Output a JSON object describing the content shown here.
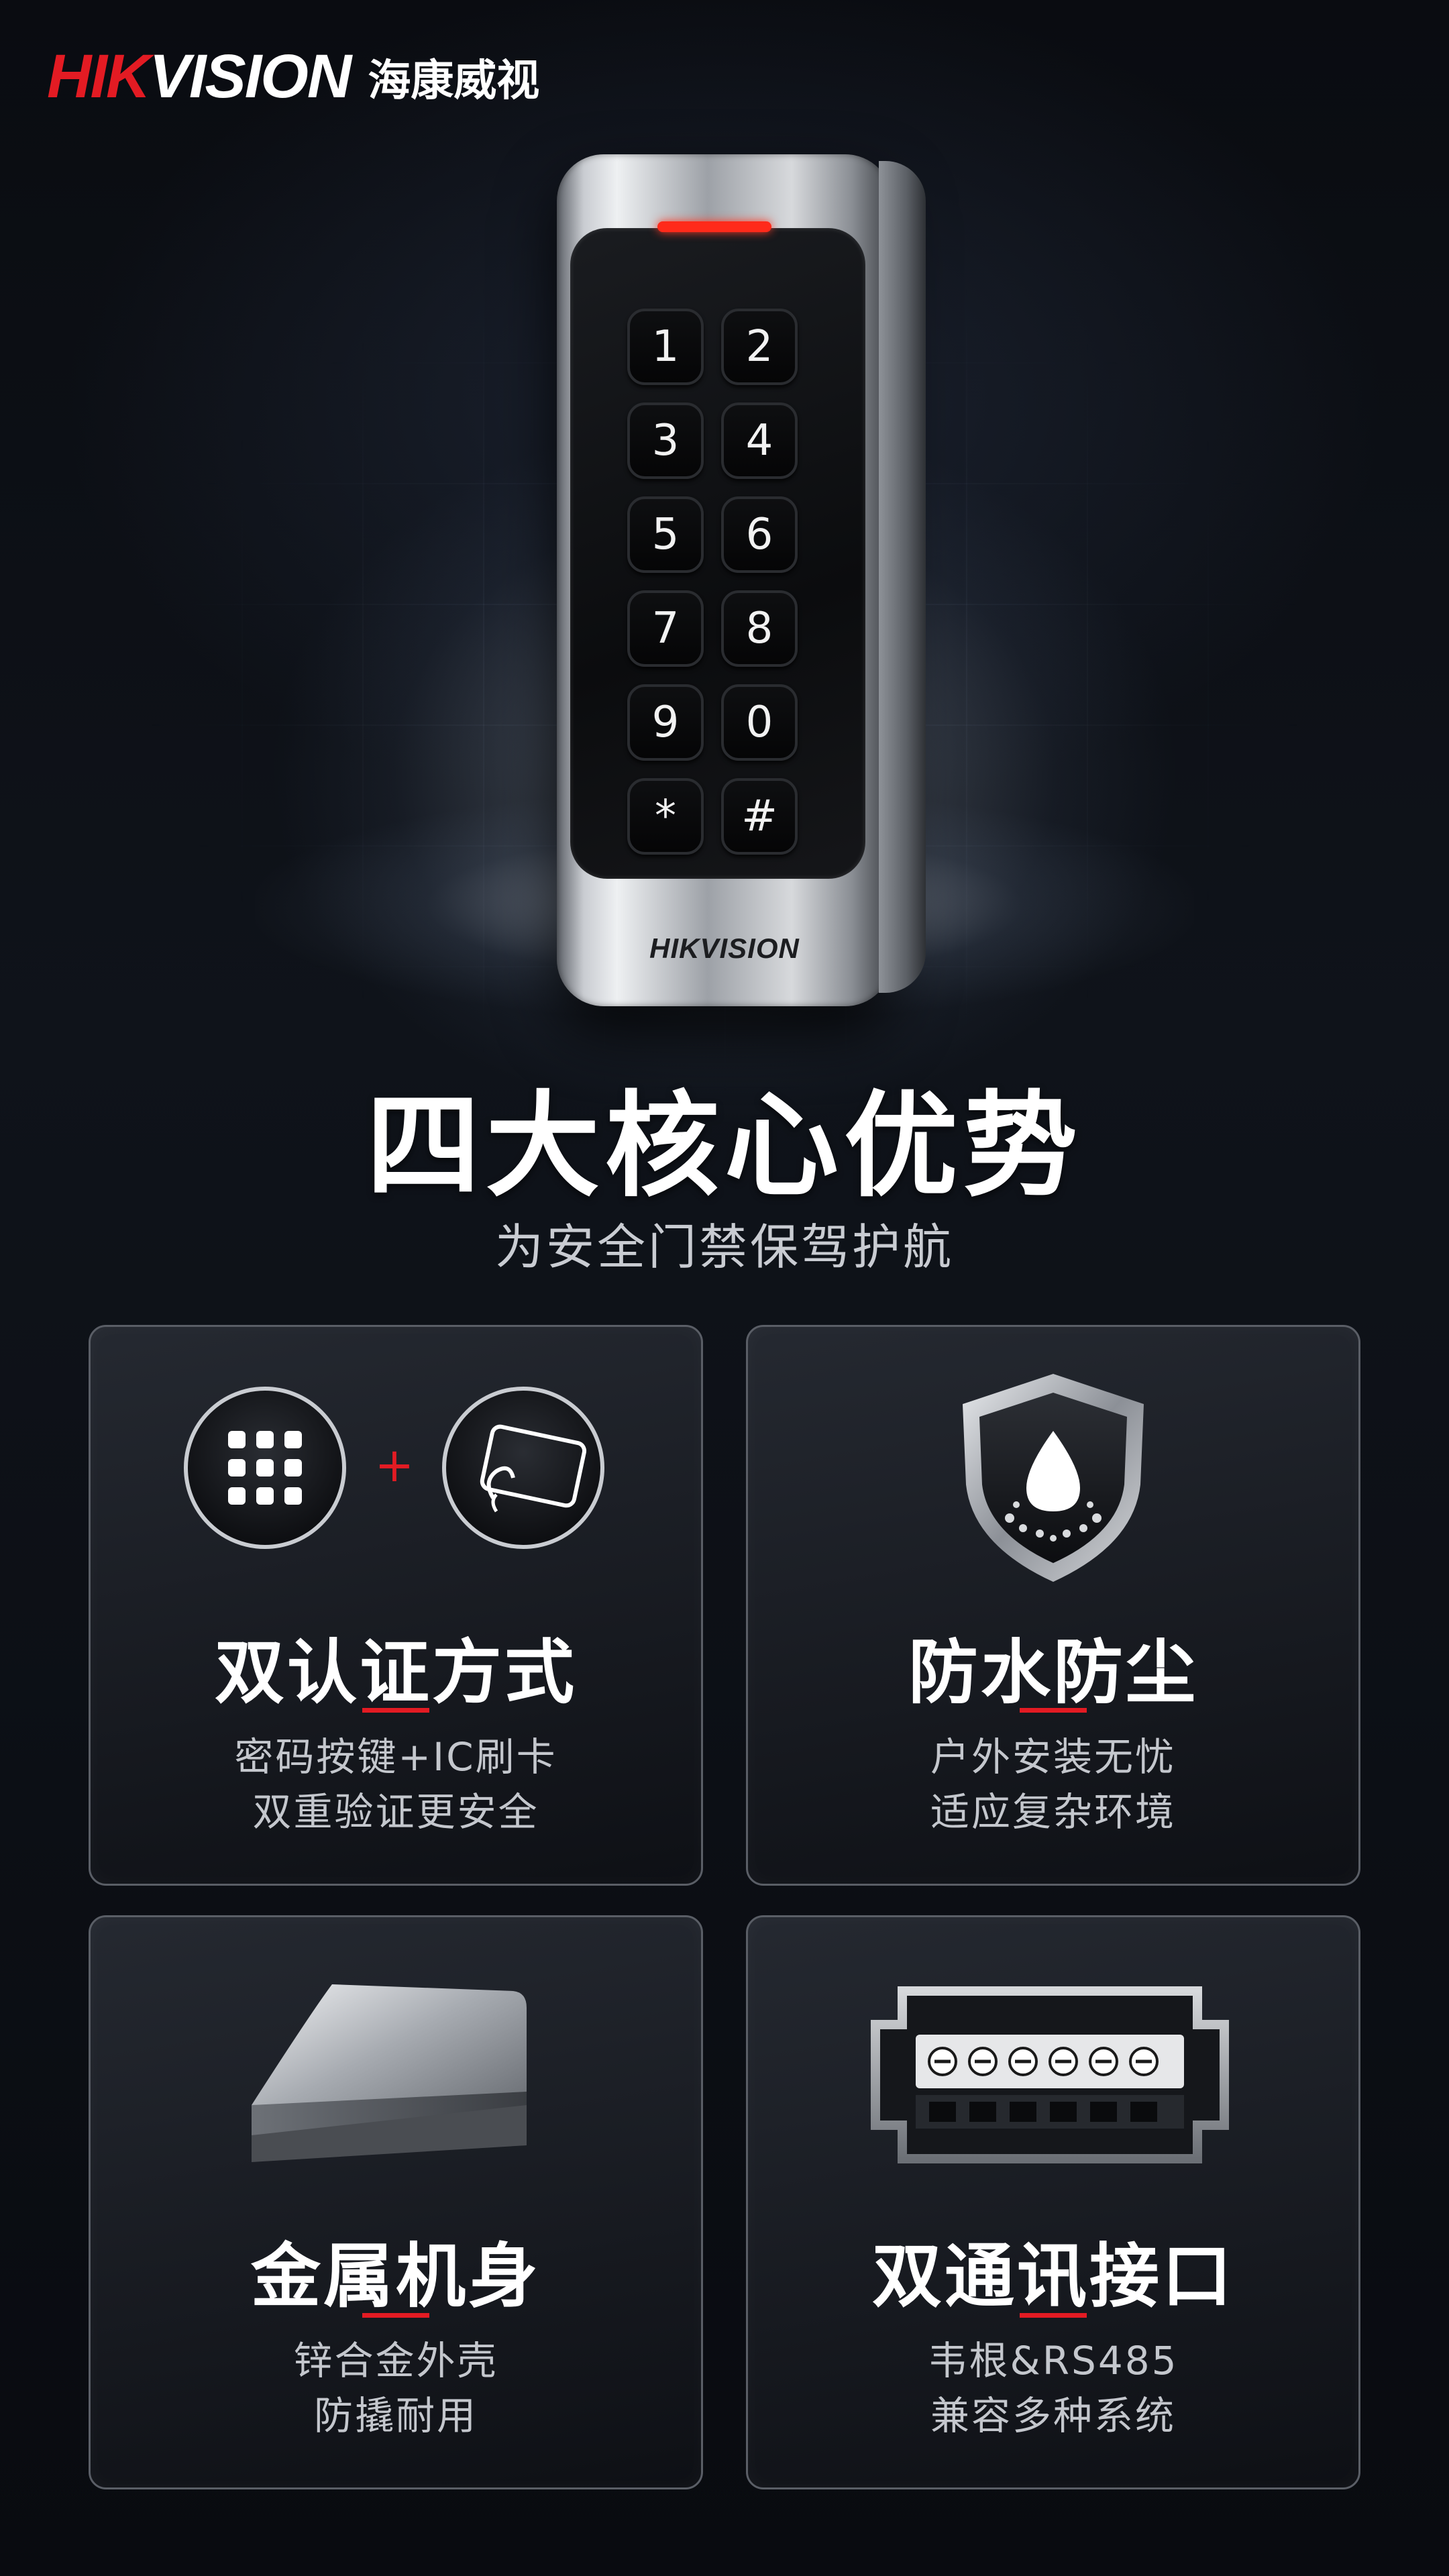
{
  "brand": {
    "logo_red": "HIK",
    "logo_white": "VISION",
    "logo_cn": "海康威视",
    "device_logo": "HIKVISION"
  },
  "keypad": {
    "keys": [
      "1",
      "2",
      "3",
      "4",
      "5",
      "6",
      "7",
      "8",
      "9",
      "0",
      "*",
      "#"
    ]
  },
  "headline": "四大核心优势",
  "subheadline": "为安全门禁保驾护航",
  "features": [
    {
      "title": "双认证方式",
      "line1": "密码按键+IC刷卡",
      "line2": "双重验证更安全",
      "icon": "keypad-plus-card-icon"
    },
    {
      "title": "防水防尘",
      "line1": "户外安装无忧",
      "line2": "适应复杂环境",
      "icon": "waterproof-shield-icon"
    },
    {
      "title": "金属机身",
      "line1": "锌合金外壳",
      "line2": "防撬耐用",
      "icon": "metal-block-icon"
    },
    {
      "title": "双通讯接口",
      "line1": "韦根&RS485",
      "line2": "兼容多种系统",
      "icon": "terminal-connector-icon"
    }
  ],
  "colors": {
    "accent": "#e31b23",
    "background": "#0b0d12",
    "card_border": "#5a5e66"
  }
}
